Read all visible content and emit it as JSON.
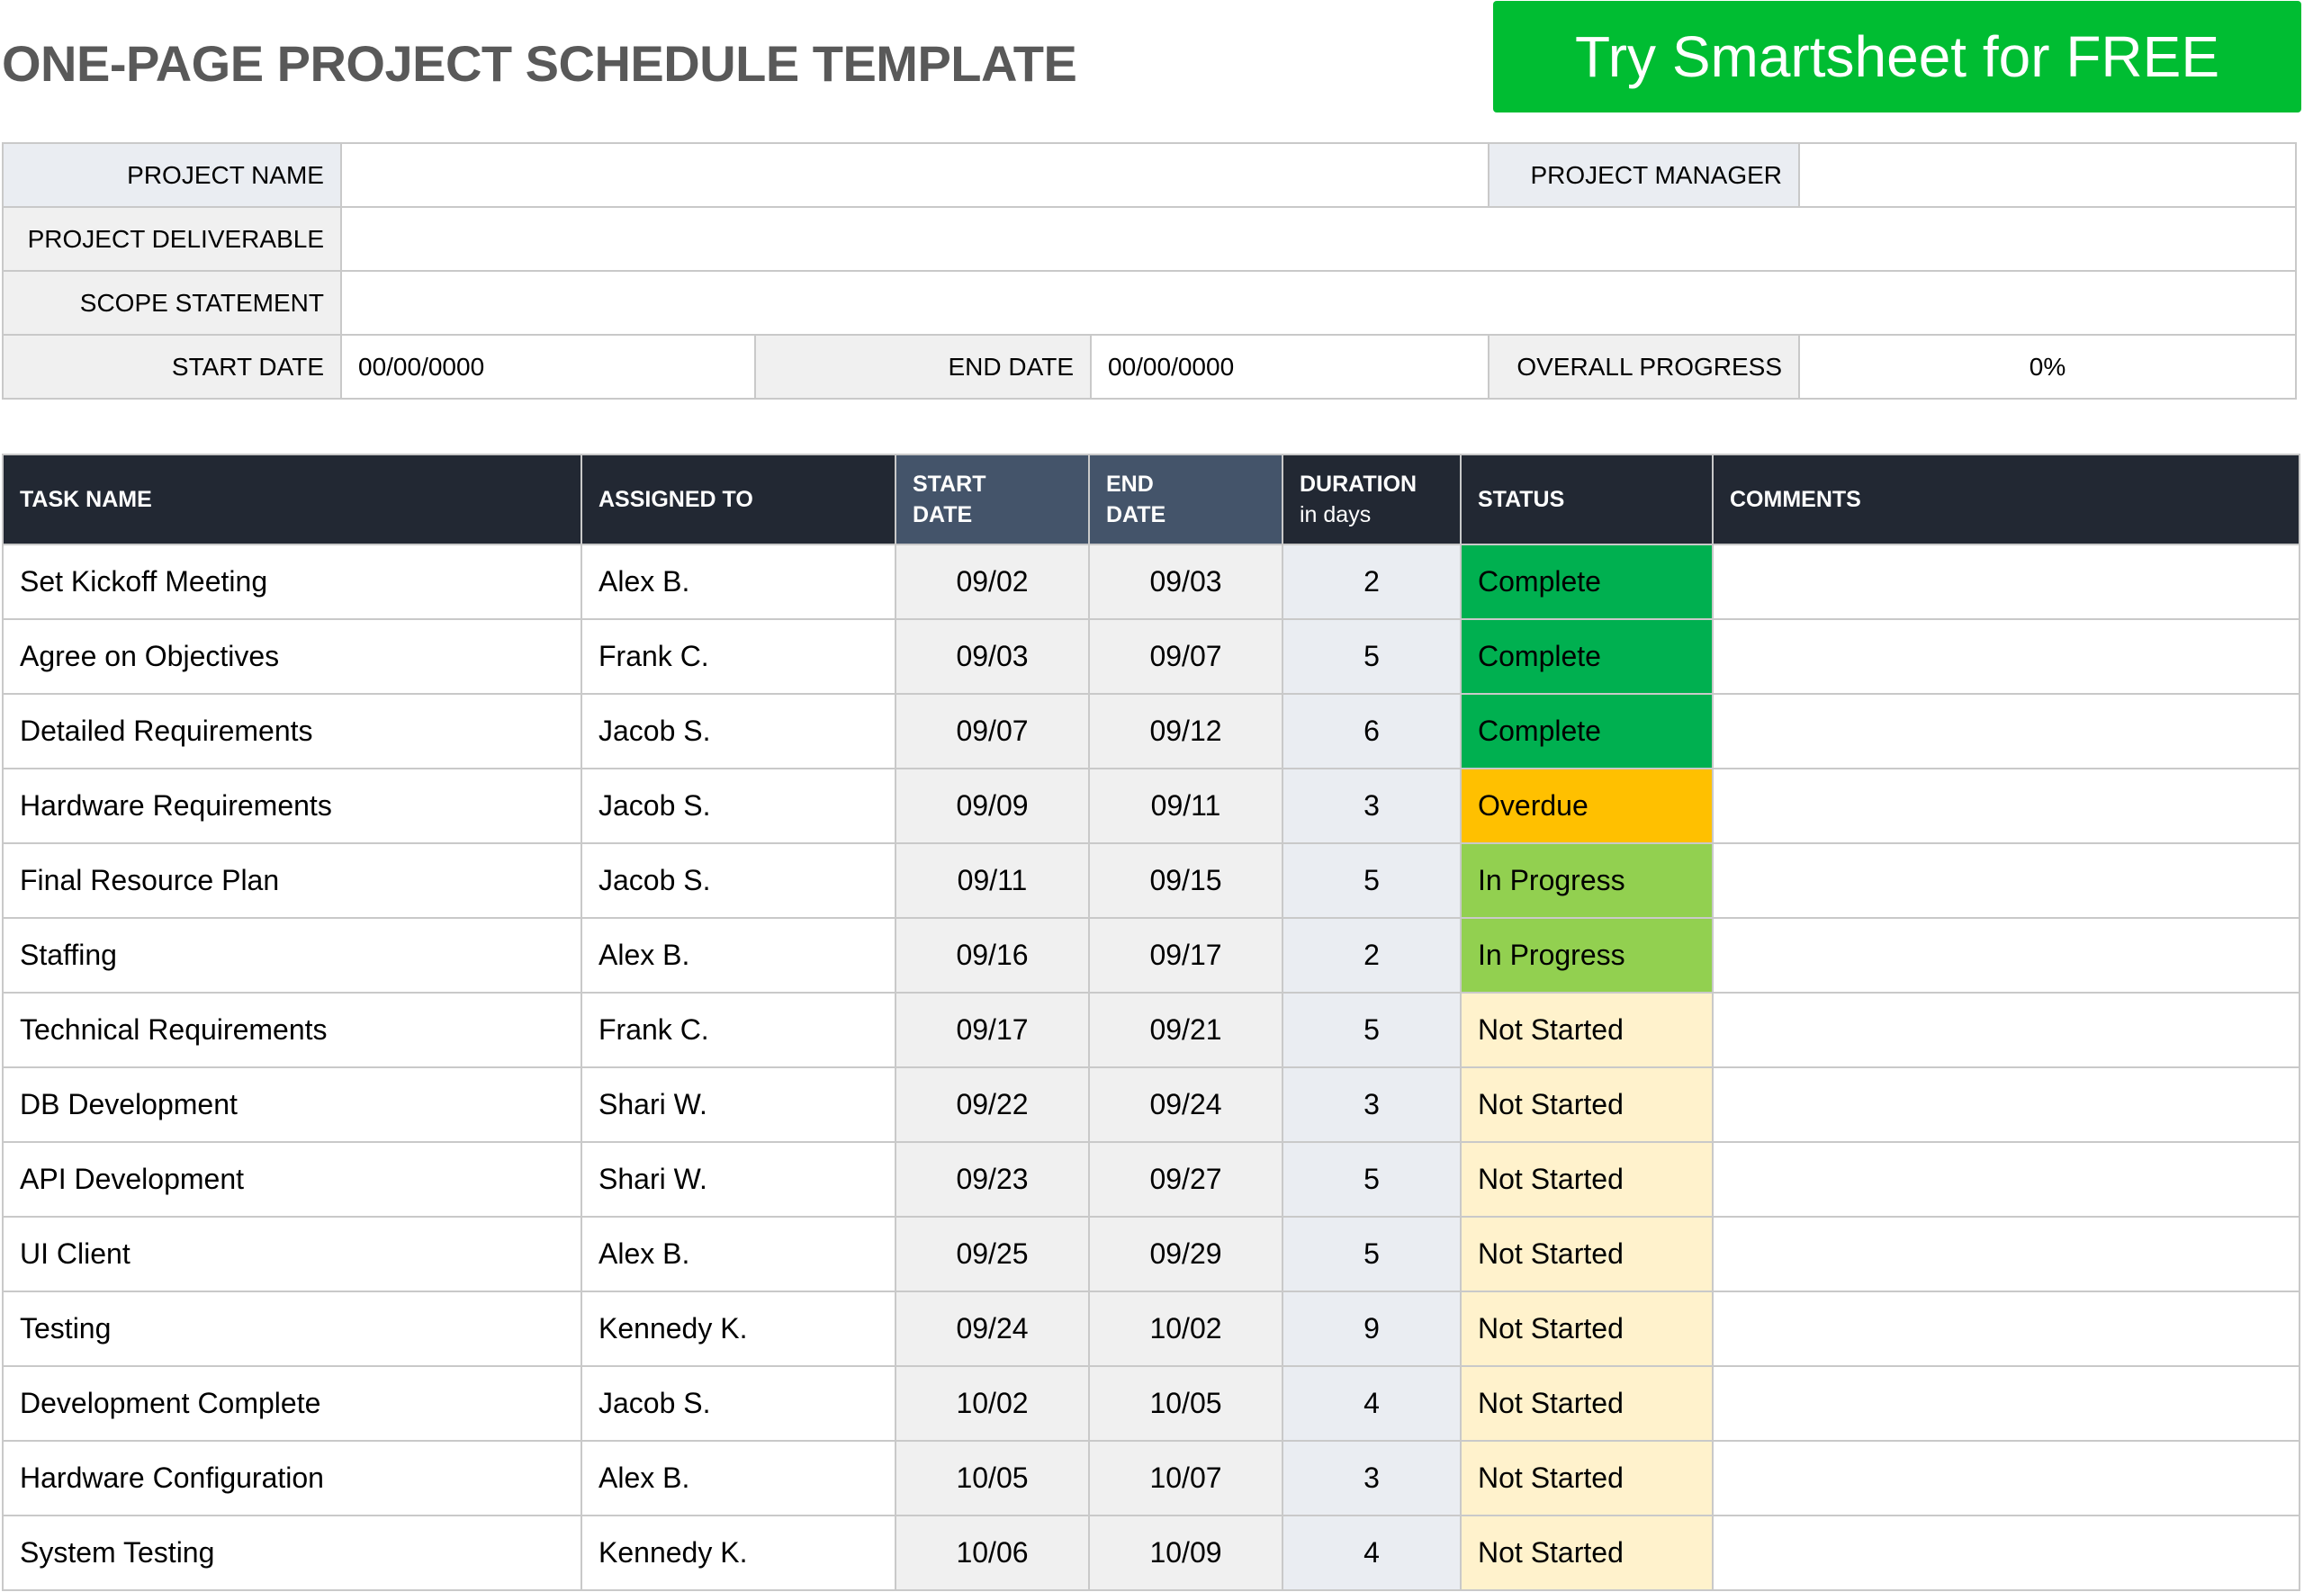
{
  "header": {
    "title": "ONE-PAGE PROJECT SCHEDULE TEMPLATE",
    "cta_label": "Try Smartsheet for FREE"
  },
  "project_info": {
    "project_name_label": "PROJECT NAME",
    "project_name_value": "",
    "project_manager_label": "PROJECT MANAGER",
    "project_manager_value": "",
    "deliverable_label": "PROJECT DELIVERABLE",
    "deliverable_value": "",
    "scope_label": "SCOPE STATEMENT",
    "scope_value": "",
    "start_date_label": "START DATE",
    "start_date_value": "00/00/0000",
    "end_date_label": "END DATE",
    "end_date_value": "00/00/0000",
    "progress_label": "OVERALL PROGRESS",
    "progress_value": "0%"
  },
  "columns": {
    "task": "TASK NAME",
    "assigned": "ASSIGNED TO",
    "start_1": "START",
    "start_2": "DATE",
    "end_1": "END",
    "end_2": "DATE",
    "duration_1": "DURATION",
    "duration_2": "in days",
    "status": "STATUS",
    "comments": "COMMENTS"
  },
  "status_colors": {
    "Complete": "#00b050",
    "Overdue": "#ffc000",
    "In Progress": "#92d050",
    "Not Started": "#fff2cc"
  },
  "tasks": [
    {
      "task": "Set Kickoff Meeting",
      "assigned": "Alex B.",
      "start": "09/02",
      "end": "09/03",
      "duration": "2",
      "status": "Complete",
      "comments": ""
    },
    {
      "task": "Agree on Objectives",
      "assigned": "Frank C.",
      "start": "09/03",
      "end": "09/07",
      "duration": "5",
      "status": "Complete",
      "comments": ""
    },
    {
      "task": "Detailed Requirements",
      "assigned": "Jacob S.",
      "start": "09/07",
      "end": "09/12",
      "duration": "6",
      "status": "Complete",
      "comments": ""
    },
    {
      "task": "Hardware Requirements",
      "assigned": "Jacob S.",
      "start": "09/09",
      "end": "09/11",
      "duration": "3",
      "status": "Overdue",
      "comments": ""
    },
    {
      "task": "Final Resource Plan",
      "assigned": "Jacob S.",
      "start": "09/11",
      "end": "09/15",
      "duration": "5",
      "status": "In Progress",
      "comments": ""
    },
    {
      "task": "Staffing",
      "assigned": "Alex B.",
      "start": "09/16",
      "end": "09/17",
      "duration": "2",
      "status": "In Progress",
      "comments": ""
    },
    {
      "task": "Technical Requirements",
      "assigned": "Frank C.",
      "start": "09/17",
      "end": "09/21",
      "duration": "5",
      "status": "Not Started",
      "comments": ""
    },
    {
      "task": "DB Development",
      "assigned": "Shari W.",
      "start": "09/22",
      "end": "09/24",
      "duration": "3",
      "status": "Not Started",
      "comments": ""
    },
    {
      "task": "API Development",
      "assigned": "Shari W.",
      "start": "09/23",
      "end": "09/27",
      "duration": "5",
      "status": "Not Started",
      "comments": ""
    },
    {
      "task": "UI Client",
      "assigned": "Alex B.",
      "start": "09/25",
      "end": "09/29",
      "duration": "5",
      "status": "Not Started",
      "comments": ""
    },
    {
      "task": "Testing",
      "assigned": "Kennedy K.",
      "start": "09/24",
      "end": "10/02",
      "duration": "9",
      "status": "Not Started",
      "comments": ""
    },
    {
      "task": "Development Complete",
      "assigned": "Jacob S.",
      "start": "10/02",
      "end": "10/05",
      "duration": "4",
      "status": "Not Started",
      "comments": ""
    },
    {
      "task": "Hardware Configuration",
      "assigned": "Alex B.",
      "start": "10/05",
      "end": "10/07",
      "duration": "3",
      "status": "Not Started",
      "comments": ""
    },
    {
      "task": "System Testing",
      "assigned": "Kennedy K.",
      "start": "10/06",
      "end": "10/09",
      "duration": "4",
      "status": "Not Started",
      "comments": ""
    }
  ]
}
